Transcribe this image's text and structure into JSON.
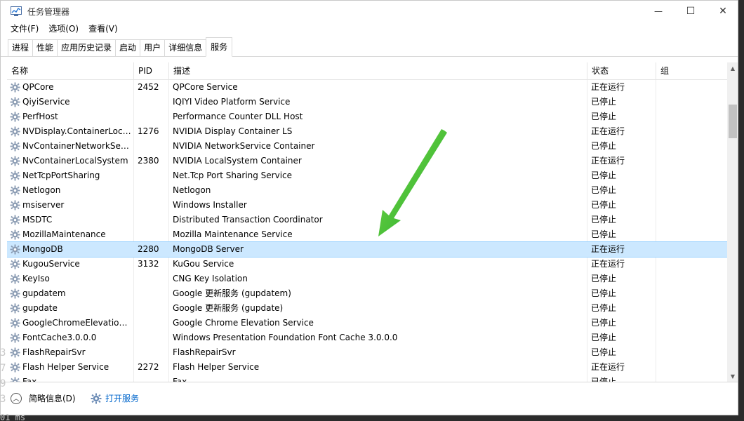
{
  "window": {
    "title": "任务管理器",
    "minimize_glyph": "—",
    "maximize_glyph": "☐",
    "close_glyph": "✕"
  },
  "menu": [
    {
      "label": "文件(F)"
    },
    {
      "label": "选项(O)"
    },
    {
      "label": "查看(V)"
    }
  ],
  "tabs": [
    {
      "label": "进程"
    },
    {
      "label": "性能"
    },
    {
      "label": "应用历史记录"
    },
    {
      "label": "启动"
    },
    {
      "label": "用户"
    },
    {
      "label": "详细信息"
    },
    {
      "label": "服务",
      "active": true
    }
  ],
  "table": {
    "columns": {
      "name": "名称",
      "pid": "PID",
      "description": "描述",
      "status": "状态",
      "group": "组"
    },
    "sort_glyph": "˄",
    "rows": [
      {
        "name": "QPCore",
        "pid": "2452",
        "description": "QPCore Service",
        "status": "正在运行",
        "group": ""
      },
      {
        "name": "QiyiService",
        "pid": "",
        "description": "IQIYI Video Platform Service",
        "status": "已停止",
        "group": ""
      },
      {
        "name": "PerfHost",
        "pid": "",
        "description": "Performance Counter DLL Host",
        "status": "已停止",
        "group": ""
      },
      {
        "name": "NVDisplay.ContainerLoc…",
        "pid": "1276",
        "description": "NVIDIA Display Container LS",
        "status": "正在运行",
        "group": ""
      },
      {
        "name": "NvContainerNetworkSer…",
        "pid": "",
        "description": "NVIDIA NetworkService Container",
        "status": "已停止",
        "group": ""
      },
      {
        "name": "NvContainerLocalSystem",
        "pid": "2380",
        "description": "NVIDIA LocalSystem Container",
        "status": "正在运行",
        "group": ""
      },
      {
        "name": "NetTcpPortSharing",
        "pid": "",
        "description": "Net.Tcp Port Sharing Service",
        "status": "已停止",
        "group": ""
      },
      {
        "name": "Netlogon",
        "pid": "",
        "description": "Netlogon",
        "status": "已停止",
        "group": ""
      },
      {
        "name": "msiserver",
        "pid": "",
        "description": "Windows Installer",
        "status": "已停止",
        "group": ""
      },
      {
        "name": "MSDTC",
        "pid": "",
        "description": "Distributed Transaction Coordinator",
        "status": "已停止",
        "group": ""
      },
      {
        "name": "MozillaMaintenance",
        "pid": "",
        "description": "Mozilla Maintenance Service",
        "status": "已停止",
        "group": ""
      },
      {
        "name": "MongoDB",
        "pid": "2280",
        "description": "MongoDB Server",
        "status": "正在运行",
        "group": "",
        "selected": true
      },
      {
        "name": "KugouService",
        "pid": "3132",
        "description": "KuGou Service",
        "status": "正在运行",
        "group": ""
      },
      {
        "name": "KeyIso",
        "pid": "",
        "description": "CNG Key Isolation",
        "status": "已停止",
        "group": ""
      },
      {
        "name": "gupdatem",
        "pid": "",
        "description": "Google 更新服务 (gupdatem)",
        "status": "已停止",
        "group": ""
      },
      {
        "name": "gupdate",
        "pid": "",
        "description": "Google 更新服务 (gupdate)",
        "status": "已停止",
        "group": ""
      },
      {
        "name": "GoogleChromeElevation…",
        "pid": "",
        "description": "Google Chrome Elevation Service",
        "status": "已停止",
        "group": ""
      },
      {
        "name": "FontCache3.0.0.0",
        "pid": "",
        "description": "Windows Presentation Foundation Font Cache 3.0.0.0",
        "status": "已停止",
        "group": ""
      },
      {
        "name": "FlashRepairSvr",
        "pid": "",
        "description": "FlashRepairSvr",
        "status": "已停止",
        "group": ""
      },
      {
        "name": "Flash Helper Service",
        "pid": "2272",
        "description": "Flash Helper Service",
        "status": "正在运行",
        "group": ""
      },
      {
        "name": "Fax",
        "pid": "",
        "description": "Fax",
        "status": "已停止",
        "group": ""
      }
    ]
  },
  "footer": {
    "fewer_details": "简略信息(D)",
    "open_services": "打开服务"
  },
  "colors": {
    "selected_row": "#cce8ff",
    "annotation_arrow": "#2db82d",
    "link": "#0066cc"
  },
  "background_console": {
    "left_chars": [
      "3",
      "7",
      "9",
      "3"
    ],
    "bottom_text": "01 ms"
  }
}
